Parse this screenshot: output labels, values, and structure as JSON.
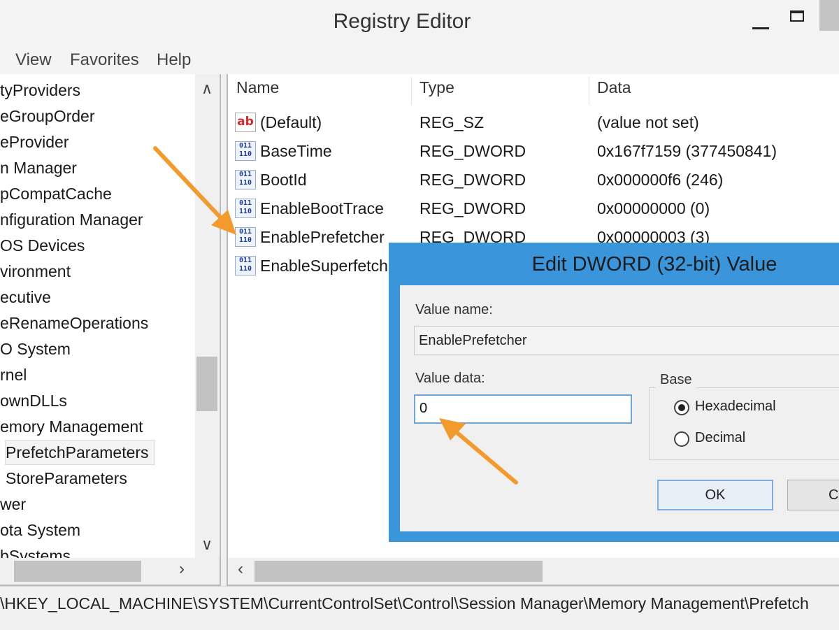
{
  "window": {
    "title": "Registry Editor"
  },
  "menu": {
    "items": [
      "View",
      "Favorites",
      "Help"
    ]
  },
  "tree": {
    "items": [
      "tyProviders",
      "eGroupOrder",
      "eProvider",
      "n Manager",
      "pCompatCache",
      "nfiguration Manager",
      "OS Devices",
      "vironment",
      "ecutive",
      "eRenameOperations",
      "O System",
      "rnel",
      "ownDLLs",
      "emory Management",
      "PrefetchParameters",
      "StoreParameters",
      "wer",
      "ota System",
      "bSystems"
    ],
    "selected": "PrefetchParameters"
  },
  "values": {
    "headers": {
      "name": "Name",
      "type": "Type",
      "data": "Data"
    },
    "rows": [
      {
        "icon": "string-value-icon",
        "icon_text": "ab",
        "name": "(Default)",
        "type": "REG_SZ",
        "data": "(value not set)"
      },
      {
        "icon": "dword-value-icon",
        "icon_text": "011\n110",
        "name": "BaseTime",
        "type": "REG_DWORD",
        "data": "0x167f7159 (377450841)"
      },
      {
        "icon": "dword-value-icon",
        "icon_text": "011\n110",
        "name": "BootId",
        "type": "REG_DWORD",
        "data": "0x000000f6 (246)"
      },
      {
        "icon": "dword-value-icon",
        "icon_text": "011\n110",
        "name": "EnableBootTrace",
        "type": "REG_DWORD",
        "data": "0x00000000 (0)"
      },
      {
        "icon": "dword-value-icon",
        "icon_text": "011\n110",
        "name": "EnablePrefetcher",
        "type": "REG_DWORD",
        "data": "0x00000003 (3)"
      },
      {
        "icon": "dword-value-icon",
        "icon_text": "011\n110",
        "name": "EnableSuperfetch",
        "type": "",
        "data": ""
      }
    ]
  },
  "status": {
    "path": "\\HKEY_LOCAL_MACHINE\\SYSTEM\\CurrentControlSet\\Control\\Session Manager\\Memory Management\\Prefetch"
  },
  "dialog": {
    "title": "Edit DWORD (32-bit) Value",
    "value_name_label": "Value name:",
    "value_name": "EnablePrefetcher",
    "value_data_label": "Value data:",
    "value_data": "0",
    "base_label": "Base",
    "base_options": [
      "Hexadecimal",
      "Decimal"
    ],
    "base_selected": "Hexadecimal",
    "ok_label": "OK",
    "cancel_label": "Ca"
  },
  "colors": {
    "dialog_frame": "#3a95db",
    "arrow": "#f39a2c"
  }
}
